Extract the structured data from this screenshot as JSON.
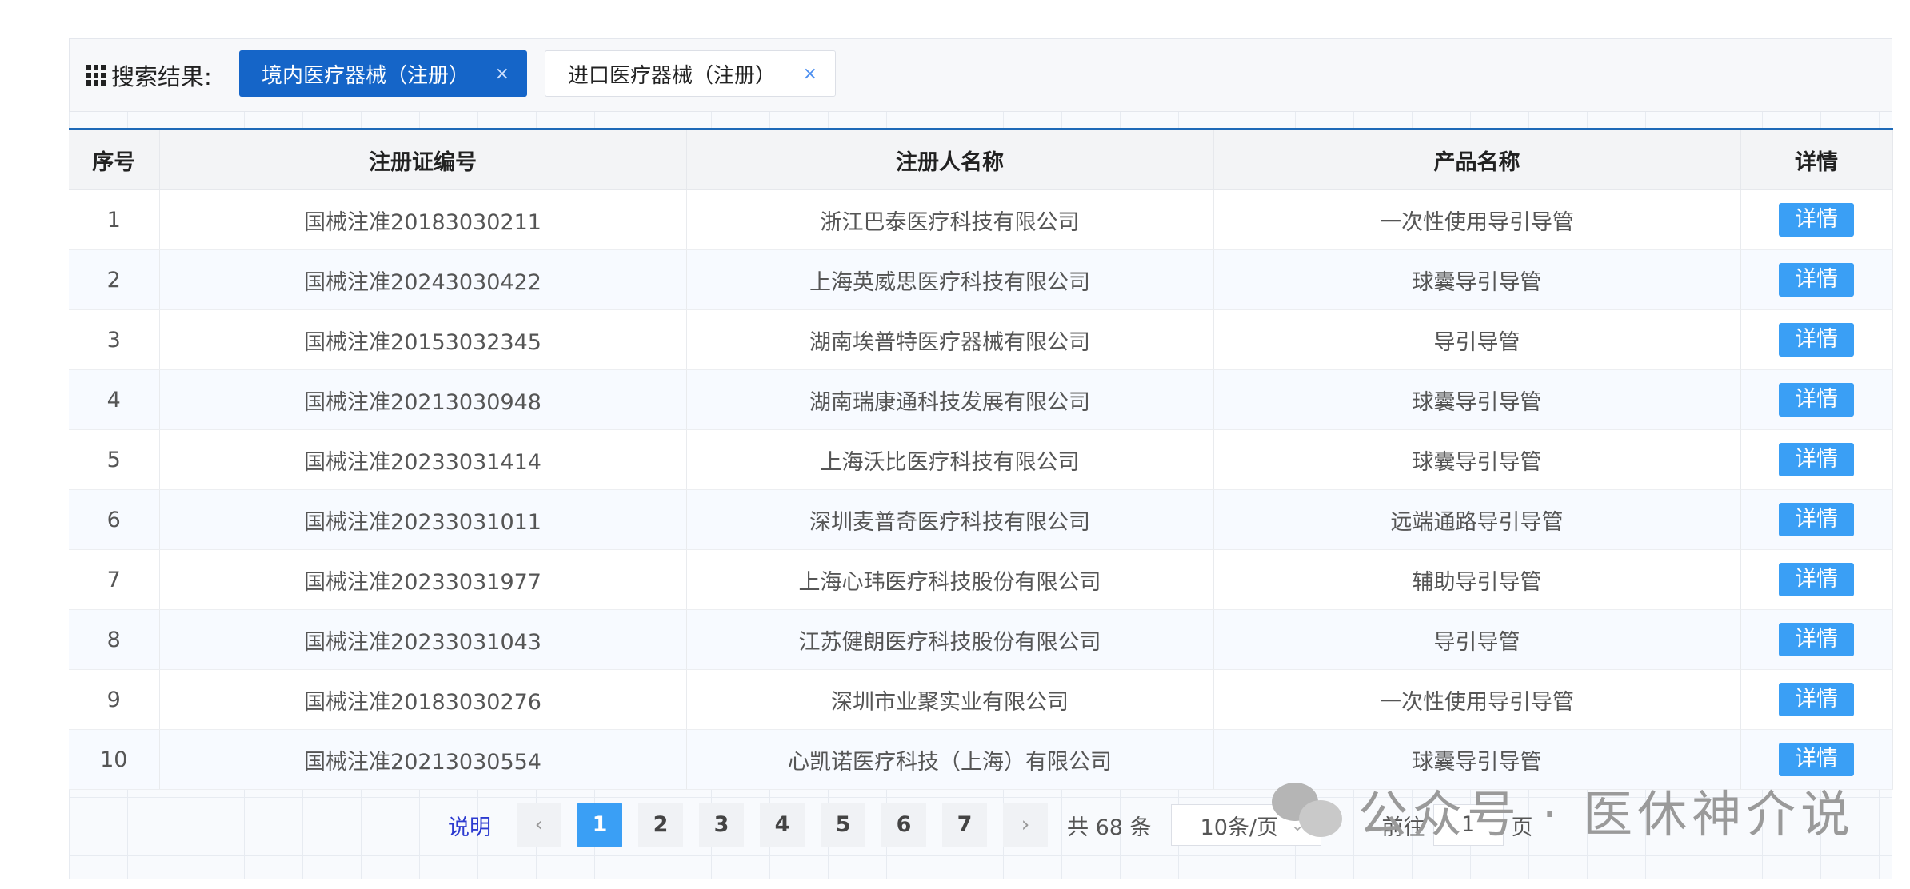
{
  "search": {
    "label": "搜索结果:",
    "tags": [
      {
        "label": "境内医疗器械（注册）",
        "close": "×"
      },
      {
        "label": "进口医疗器械（注册）",
        "close": "×"
      }
    ]
  },
  "table": {
    "headers": [
      "序号",
      "注册证编号",
      "注册人名称",
      "产品名称",
      "详情"
    ],
    "detail_label": "详情",
    "rows": [
      {
        "no": "1",
        "reg": "国械注准20183030211",
        "company": "浙江巴泰医疗科技有限公司",
        "product": "一次性使用导引导管"
      },
      {
        "no": "2",
        "reg": "国械注准20243030422",
        "company": "上海英威思医疗科技有限公司",
        "product": "球囊导引导管"
      },
      {
        "no": "3",
        "reg": "国械注准20153032345",
        "company": "湖南埃普特医疗器械有限公司",
        "product": "导引导管"
      },
      {
        "no": "4",
        "reg": "国械注准20213030948",
        "company": "湖南瑞康通科技发展有限公司",
        "product": "球囊导引导管"
      },
      {
        "no": "5",
        "reg": "国械注准20233031414",
        "company": "上海沃比医疗科技有限公司",
        "product": "球囊导引导管"
      },
      {
        "no": "6",
        "reg": "国械注准20233031011",
        "company": "深圳麦普奇医疗科技有限公司",
        "product": "远端通路导引导管"
      },
      {
        "no": "7",
        "reg": "国械注准20233031977",
        "company": "上海心玮医疗科技股份有限公司",
        "product": "辅助导引导管"
      },
      {
        "no": "8",
        "reg": "国械注准20233031043",
        "company": "江苏健朗医疗科技股份有限公司",
        "product": "导引导管"
      },
      {
        "no": "9",
        "reg": "国械注准20183030276",
        "company": "深圳市业聚实业有限公司",
        "product": "一次性使用导引导管"
      },
      {
        "no": "10",
        "reg": "国械注准20213030554",
        "company": "心凯诺医疗科技（上海）有限公司",
        "product": "球囊导引导管"
      }
    ]
  },
  "pager": {
    "help": "说明",
    "prev": "‹",
    "next": "›",
    "pages": [
      "1",
      "2",
      "3",
      "4",
      "5",
      "6",
      "7"
    ],
    "active_page": "1",
    "total": "共 68 条",
    "page_size": "10条/页",
    "goto_label": "前往",
    "goto_value": "1",
    "page_suffix": "页"
  },
  "watermark": {
    "text": "公众号 · 医休神介说"
  },
  "colors": {
    "accent": "#1565c8",
    "button": "#3a9ff5",
    "link": "#2d3bd0"
  }
}
